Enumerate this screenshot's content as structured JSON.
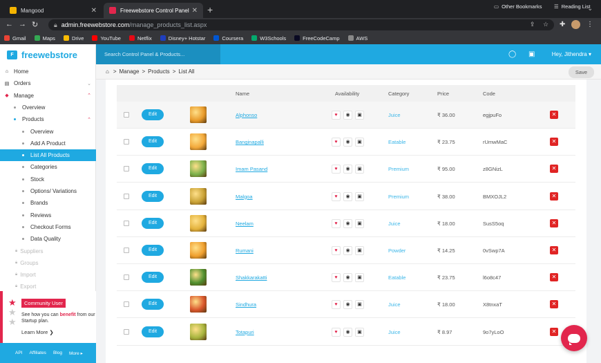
{
  "browser": {
    "tabs": [
      {
        "title": "Mangood",
        "favicon_color": "#f4b400"
      },
      {
        "title": "Freewebstore Control Panel",
        "favicon_color": "#e2264d"
      }
    ],
    "url_domain": "admin.freewebstore.com",
    "url_path": "/manage_products_list.aspx",
    "bookmarks": [
      {
        "label": "Gmail",
        "color": "#ea4335"
      },
      {
        "label": "Maps",
        "color": "#34a853"
      },
      {
        "label": "Drive",
        "color": "#fbbc04"
      },
      {
        "label": "YouTube",
        "color": "#ff0000"
      },
      {
        "label": "Netflix",
        "color": "#e50914"
      },
      {
        "label": "Disney+ Hotstar",
        "color": "#1f3fbf"
      },
      {
        "label": "Coursera",
        "color": "#0056d2"
      },
      {
        "label": "W3Schools",
        "color": "#04aa6d"
      },
      {
        "label": "FreeCodeCamp",
        "color": "#0a0a23"
      },
      {
        "label": "AWS",
        "color": "#888888"
      }
    ],
    "other_bookmarks": "Other Bookmarks",
    "reading_list": "Reading List"
  },
  "app": {
    "brand": "freewebstore",
    "search_placeholder": "Search Control Panel & Products...",
    "user_greeting": "Hey, Jithendra ▾",
    "accent": "#1fa9e1",
    "danger": "#e2264d"
  },
  "sidebar": {
    "items": [
      {
        "label": "Home",
        "icon": "home-icon",
        "glyph": "⌂",
        "level": 0
      },
      {
        "label": "Orders",
        "icon": "orders-icon",
        "glyph": "▤",
        "level": 0,
        "chevron": "⌄"
      },
      {
        "label": "Manage",
        "icon": "manage-icon",
        "glyph": "◆",
        "level": 0,
        "chevron": "⌃"
      },
      {
        "label": "Overview",
        "level": 1
      },
      {
        "label": "Products",
        "level": 1,
        "chevron": "⌃"
      },
      {
        "label": "Overview",
        "level": 2
      },
      {
        "label": "Add A Product",
        "level": 2
      },
      {
        "label": "List All Products",
        "level": 2,
        "active": true
      },
      {
        "label": "Categories",
        "level": 2
      },
      {
        "label": "Stock",
        "level": 2
      },
      {
        "label": "Options/ Variations",
        "level": 2
      },
      {
        "label": "Brands",
        "level": 2
      },
      {
        "label": "Reviews",
        "level": 2
      },
      {
        "label": "Checkout Forms",
        "level": 2
      },
      {
        "label": "Data Quality",
        "level": 2
      },
      {
        "label": "Suppliers",
        "level": 2,
        "disabled": true
      },
      {
        "label": "Groups",
        "level": 2,
        "disabled": true
      },
      {
        "label": "Import",
        "level": 2,
        "disabled": true
      },
      {
        "label": "Export",
        "level": 2,
        "disabled": true
      }
    ],
    "community": {
      "badge": "Community User",
      "text_before": "See how you can ",
      "text_bold": "benefit",
      "text_after": " from our Startup plan.",
      "learn_more": "Learn More ❯",
      "stars_filled": 1,
      "stars_total": 3
    },
    "footer_links": [
      "API",
      "Affiliates",
      "Blog",
      "More ▸"
    ]
  },
  "breadcrumb": {
    "items": [
      "Manage",
      "Products",
      "List All"
    ],
    "save_label": "Save"
  },
  "table": {
    "headers": {
      "name": "Name",
      "availability": "Availability",
      "category": "Category",
      "price": "Price",
      "code": "Code"
    },
    "edit_label": "Edit",
    "rows": [
      {
        "name": "Alphonso",
        "category": "Juice",
        "price": "₹ 36.00",
        "code": "egjpuFo",
        "thumb": "#e89a2a"
      },
      {
        "name": "Banginapalli",
        "category": "Eatable",
        "price": "₹ 23.75",
        "code": "rUmwMaC",
        "thumb": "#f2a83a"
      },
      {
        "name": "Imam Pasand",
        "category": "Premium",
        "price": "₹ 95.00",
        "code": "z8GNizL",
        "thumb": "#7ab04a"
      },
      {
        "name": "Malgoa",
        "category": "Premium",
        "price": "₹ 38.00",
        "code": "BMXOJL2",
        "thumb": "#c9a236"
      },
      {
        "name": "Neelam",
        "category": "Juice",
        "price": "₹ 18.00",
        "code": "SusS5oq",
        "thumb": "#e3b23c"
      },
      {
        "name": "Rumani",
        "category": "Powder",
        "price": "₹ 14.25",
        "code": "0vSwp7A",
        "thumb": "#ef9f2e"
      },
      {
        "name": "Shakkarakatti",
        "category": "Eatable",
        "price": "₹ 23.75",
        "code": "l6o8c47",
        "thumb": "#4f8f2f"
      },
      {
        "name": "Sindhura",
        "category": "Juice",
        "price": "₹ 18.00",
        "code": "X8tnxaT",
        "thumb": "#d9562c"
      },
      {
        "name": "Totapuri",
        "category": "Juice",
        "price": "₹ 8.97",
        "code": "9o7yLoO",
        "thumb": "#a8b53e"
      }
    ]
  }
}
